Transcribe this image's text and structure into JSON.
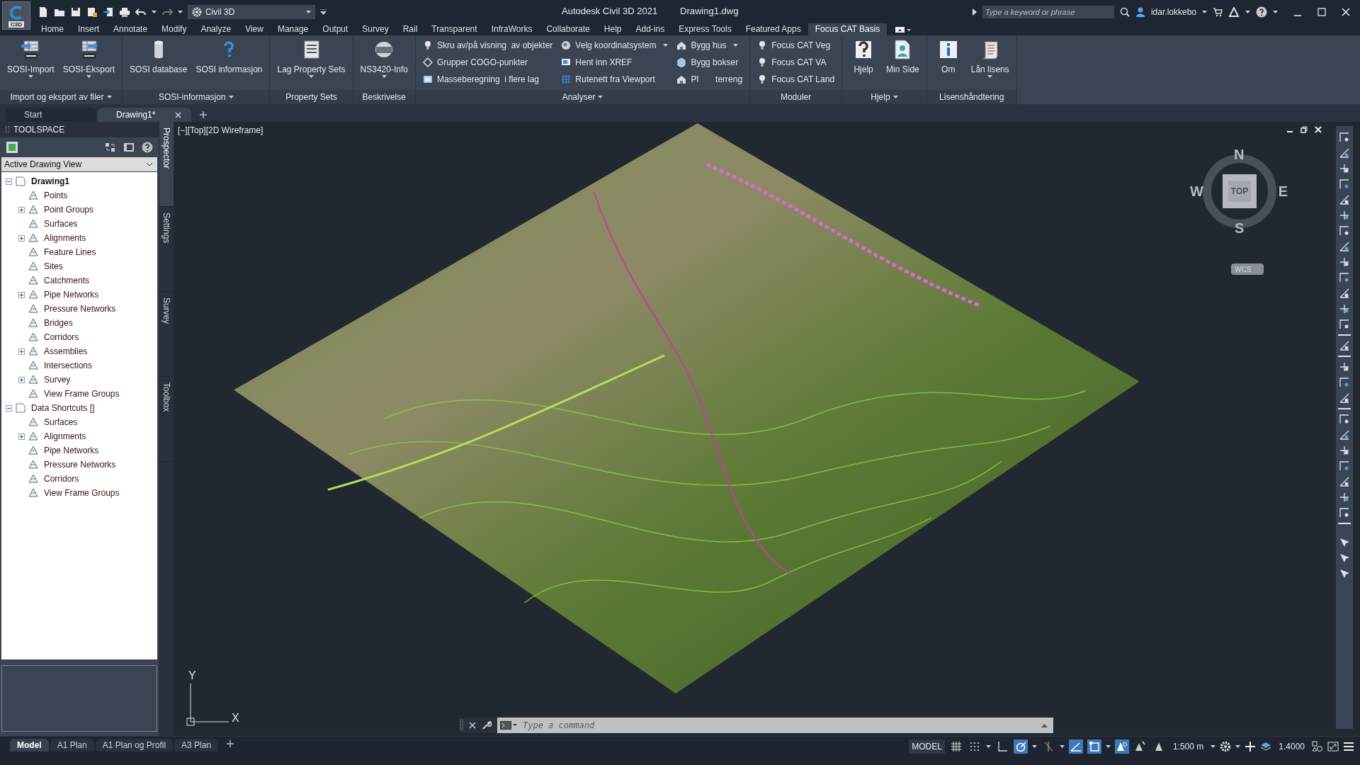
{
  "window": {
    "app_badge": "C3D",
    "title": "Autodesk Civil 3D 2021",
    "file": "Drawing1.dwg"
  },
  "workspace": {
    "value": "Civil 3D"
  },
  "search": {
    "placeholder": "Type a keyword or phrase"
  },
  "user": {
    "name": "idar.lokkebo"
  },
  "menu_tabs": [
    {
      "label": "Home",
      "selected": false
    },
    {
      "label": "Insert",
      "selected": false
    },
    {
      "label": "Annotate",
      "selected": false
    },
    {
      "label": "Modify",
      "selected": false
    },
    {
      "label": "Analyze",
      "selected": false
    },
    {
      "label": "View",
      "selected": false
    },
    {
      "label": "Manage",
      "selected": false
    },
    {
      "label": "Output",
      "selected": false
    },
    {
      "label": "Survey",
      "selected": false
    },
    {
      "label": "Rail",
      "selected": false
    },
    {
      "label": "Transparent",
      "selected": false
    },
    {
      "label": "InfraWorks",
      "selected": false
    },
    {
      "label": "Collaborate",
      "selected": false
    },
    {
      "label": "Help",
      "selected": false
    },
    {
      "label": "Add-ins",
      "selected": false
    },
    {
      "label": "Express Tools",
      "selected": false
    },
    {
      "label": "Featured Apps",
      "selected": false
    },
    {
      "label": "Focus CAT Basis",
      "selected": true
    }
  ],
  "ribbon_panels": [
    {
      "title": "Import og eksport av filer",
      "has_menu": true,
      "buttons": [
        {
          "kind": "large",
          "label": "SOSI-Import",
          "dropdown": true
        },
        {
          "kind": "large",
          "label": "SOSI-Eksport",
          "dropdown": true
        }
      ]
    },
    {
      "title": "SOSI-informasjon",
      "has_menu": true,
      "buttons": [
        {
          "kind": "large",
          "label": "SOSI database",
          "dropdown": false
        },
        {
          "kind": "large",
          "label": "SOSI informasjon",
          "dropdown": false
        }
      ]
    },
    {
      "title": "Property Sets",
      "has_menu": false,
      "buttons": [
        {
          "kind": "large",
          "label": "Lag Property Sets",
          "dropdown": true
        }
      ]
    },
    {
      "title": "Beskrivelse",
      "has_menu": false,
      "buttons": [
        {
          "kind": "large",
          "label": "NS3420-Info",
          "dropdown": true
        }
      ]
    },
    {
      "title": "Analyser",
      "has_menu": true,
      "buttons": [
        {
          "kind": "small",
          "label": "Skru av/på visning  av objekter",
          "dropdown": false
        },
        {
          "kind": "small",
          "label": "Grupper COGO-punkter",
          "dropdown": false
        },
        {
          "kind": "small",
          "label": "Masseberegning  i flere lag",
          "dropdown": false
        },
        {
          "kind": "small",
          "label": "Velg koordinatsystem",
          "dropdown": true
        },
        {
          "kind": "small",
          "label": "Hent inn XREF",
          "dropdown": false
        },
        {
          "kind": "small",
          "label": "Rutenett fra Viewport",
          "dropdown": false
        },
        {
          "kind": "small",
          "label": "Bygg hus",
          "dropdown": true
        },
        {
          "kind": "small",
          "label": "Bygg bokser",
          "dropdown": false
        },
        {
          "kind": "small",
          "label": "Pl",
          "dropdown": false,
          "tail": "terreng"
        }
      ]
    },
    {
      "title": "Moduler",
      "has_menu": false,
      "buttons": [
        {
          "kind": "small",
          "label": "Focus CAT Veg",
          "dropdown": false
        },
        {
          "kind": "small",
          "label": "Focus CAT VA",
          "dropdown": false
        },
        {
          "kind": "small",
          "label": "Focus CAT Land",
          "dropdown": false
        }
      ]
    },
    {
      "title": "Hjelp",
      "has_menu": true,
      "buttons": [
        {
          "kind": "large",
          "label": "Hjelp",
          "dropdown": false
        },
        {
          "kind": "large",
          "label": "Min Side",
          "dropdown": false
        }
      ]
    },
    {
      "title": "Lisenshåndtering",
      "has_menu": false,
      "buttons": [
        {
          "kind": "large",
          "label": "Om",
          "dropdown": false
        },
        {
          "kind": "large",
          "label": "Lån lisens",
          "dropdown": true
        }
      ]
    }
  ],
  "doc_tabs": [
    {
      "label": "Start",
      "selected": false
    },
    {
      "label": "Drawing1*",
      "selected": true
    }
  ],
  "toolspace": {
    "title": "TOOLSPACE",
    "view": "Active Drawing View",
    "tree": [
      {
        "label": "Drawing1",
        "kind": "group",
        "expanded": true,
        "active": true,
        "children": [
          {
            "label": "Points",
            "kind": "leaf"
          },
          {
            "label": "Point Groups",
            "kind": "group",
            "expanded": false
          },
          {
            "label": "Surfaces",
            "kind": "leaf"
          },
          {
            "label": "Alignments",
            "kind": "group",
            "expanded": false
          },
          {
            "label": "Feature Lines",
            "kind": "leaf"
          },
          {
            "label": "Sites",
            "kind": "leaf"
          },
          {
            "label": "Catchments",
            "kind": "leaf"
          },
          {
            "label": "Pipe Networks",
            "kind": "group",
            "expanded": false
          },
          {
            "label": "Pressure Networks",
            "kind": "leaf"
          },
          {
            "label": "Bridges",
            "kind": "leaf"
          },
          {
            "label": "Corridors",
            "kind": "leaf"
          },
          {
            "label": "Assemblies",
            "kind": "group",
            "expanded": false
          },
          {
            "label": "Intersections",
            "kind": "leaf"
          },
          {
            "label": "Survey",
            "kind": "group",
            "expanded": false
          },
          {
            "label": "View Frame Groups",
            "kind": "leaf"
          }
        ]
      },
      {
        "label": "Data Shortcuts []",
        "kind": "group",
        "expanded": true,
        "active": false,
        "children": [
          {
            "label": "Surfaces",
            "kind": "leaf"
          },
          {
            "label": "Alignments",
            "kind": "group",
            "expanded": false
          },
          {
            "label": "Pipe Networks",
            "kind": "leaf"
          },
          {
            "label": "Pressure Networks",
            "kind": "leaf"
          },
          {
            "label": "Corridors",
            "kind": "leaf"
          },
          {
            "label": "View Frame Groups",
            "kind": "leaf"
          }
        ]
      }
    ],
    "side_tabs": [
      {
        "label": "Prospector",
        "selected": true
      },
      {
        "label": "Settings",
        "selected": false
      },
      {
        "label": "Survey",
        "selected": false
      },
      {
        "label": "Toolbox",
        "selected": false
      }
    ]
  },
  "viewport": {
    "label": "[−][Top][2D Wireframe]",
    "compass": {
      "north": "N",
      "east": "E",
      "south": "S",
      "west": "W",
      "face": "TOP"
    },
    "ucs": "WCS",
    "axis_x": "X",
    "axis_y": "Y"
  },
  "command": {
    "placeholder": "Type a command"
  },
  "layout_tabs": [
    {
      "label": "Model",
      "selected": true
    },
    {
      "label": "A1 Plan",
      "selected": false
    },
    {
      "label": "A1 Plan og Profil",
      "selected": false
    },
    {
      "label": "A3 Plan",
      "selected": false
    }
  ],
  "status_bar": {
    "mode": "MODEL",
    "scale": "1:500 m",
    "annotation_value": "1.4000",
    "toggles": [
      {
        "kind": "grid",
        "on": false
      },
      {
        "kind": "snap",
        "on": false
      },
      {
        "kind": "ortho",
        "on": false
      },
      {
        "kind": "polar",
        "on": true
      },
      {
        "kind": "isodraft",
        "on": false
      },
      {
        "kind": "tracking",
        "on": true
      },
      {
        "kind": "osnap",
        "on": true
      },
      {
        "kind": "annotation",
        "on": true
      },
      {
        "kind": "autoscale",
        "on": false
      },
      {
        "kind": "annoscale",
        "on": false
      }
    ]
  }
}
